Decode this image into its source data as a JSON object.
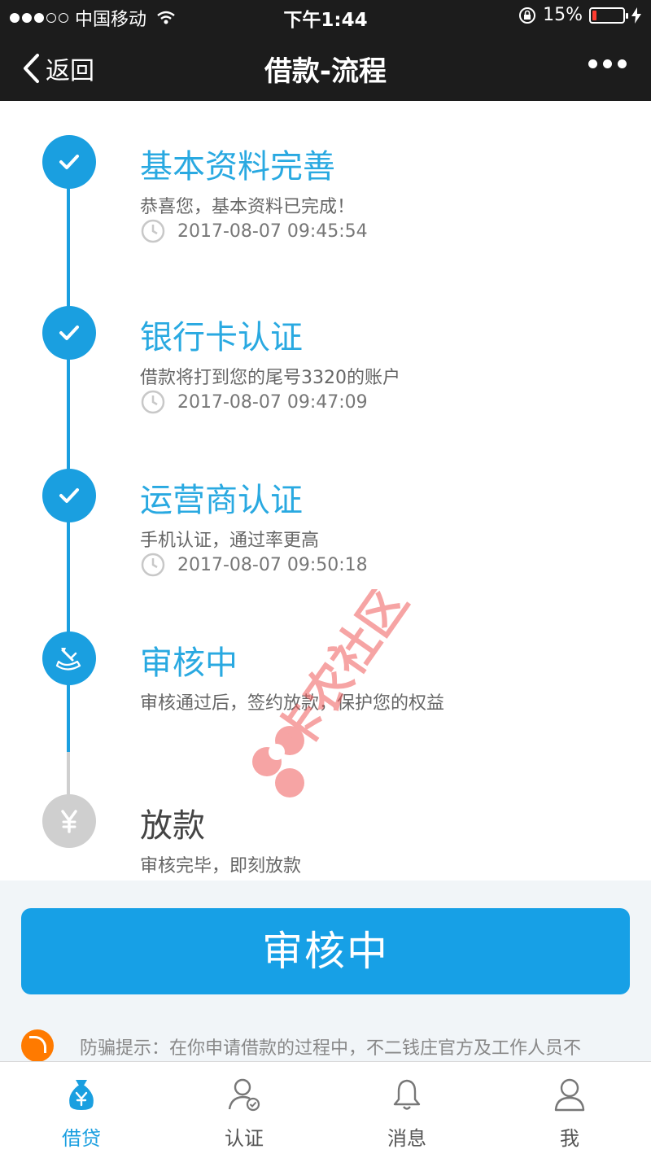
{
  "status_bar": {
    "carrier": "中国移动",
    "time": "下午1:44",
    "battery_percent": "15%",
    "battery_level": 0.15,
    "battery_color": "#ff3b30"
  },
  "nav": {
    "back_label": "返回",
    "title": "借款-流程"
  },
  "steps": [
    {
      "title": "基本资料完善",
      "desc": "恭喜您，基本资料已完成！",
      "time": "2017-08-07 09:45:54",
      "status": "done",
      "icon": "check-icon"
    },
    {
      "title": "银行卡认证",
      "desc": "借款将打到您的尾号3320的账户",
      "time": "2017-08-07 09:47:09",
      "status": "done",
      "icon": "check-icon"
    },
    {
      "title": "运营商认证",
      "desc": "手机认证，通过率更高",
      "time": "2017-08-07 09:50:18",
      "status": "done",
      "icon": "check-icon"
    },
    {
      "title": "审核中",
      "desc": "审核通过后，签约放款，保护您的权益",
      "status": "active",
      "icon": "review-stamp-icon"
    },
    {
      "title": "放款",
      "desc": "审核完毕，即刻放款",
      "status": "pending",
      "icon": "yen-icon"
    }
  ],
  "watermark_text": "卡农社区",
  "action_button": "审核中",
  "tip_text": "防骗提示：在你申请借款的过程中，不二钱庄官方及工作人员不",
  "tabs": [
    {
      "label": "借贷",
      "icon": "money-bag-icon",
      "active": true
    },
    {
      "label": "认证",
      "icon": "user-verified-icon",
      "active": false
    },
    {
      "label": "消息",
      "icon": "bell-icon",
      "active": false
    },
    {
      "label": "我",
      "icon": "user-icon",
      "active": false
    }
  ],
  "colors": {
    "accent": "#1a9fe0",
    "title_blue": "#29a9e1",
    "pending_gray": "#cfcfcf",
    "tip_orange": "#ff7a00"
  }
}
